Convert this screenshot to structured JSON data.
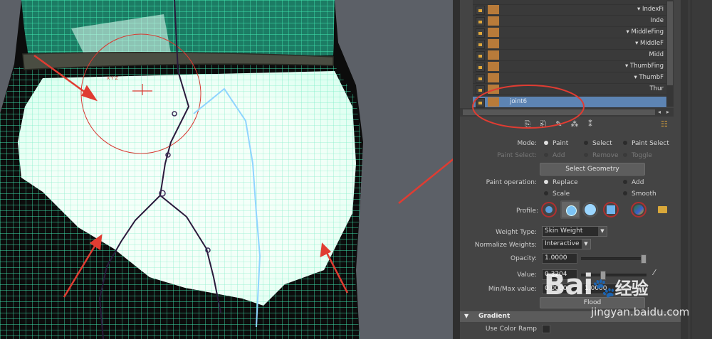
{
  "outliner": {
    "rows": [
      {
        "label": "IndexFi",
        "arrow": true
      },
      {
        "label": "Inde",
        "arrow": false
      },
      {
        "label": "MiddleFing",
        "arrow": true
      },
      {
        "label": "MiddleF",
        "arrow": true
      },
      {
        "label": "Midd",
        "arrow": false
      },
      {
        "label": "ThumbFing",
        "arrow": true
      },
      {
        "label": "ThumbF",
        "arrow": true
      },
      {
        "label": "Thur",
        "arrow": false
      },
      {
        "label": "joint6",
        "arrow": false,
        "selected": true
      }
    ]
  },
  "tool": {
    "mode_label": "Mode:",
    "mode_options": [
      "Paint",
      "Select",
      "Paint Select"
    ],
    "mode_selected": "Paint",
    "paint_select_label": "Paint Select:",
    "paint_select_options": [
      "Add",
      "Remove",
      "Toggle"
    ],
    "select_geometry_label": "Select Geometry",
    "paint_operation_label": "Paint operation:",
    "paint_operation_options": [
      "Replace",
      "Add",
      "Scale",
      "Smooth"
    ],
    "paint_operation_selected": "Replace",
    "profile_label": "Profile:",
    "weight_type_label": "Weight Type:",
    "weight_type_value": "Skin Weight",
    "normalize_label": "Normalize Weights:",
    "normalize_value": "Interactive",
    "opacity_label": "Opacity:",
    "opacity_value": "1.0000",
    "opacity_fraction": 1.0,
    "value_label": "Value:",
    "value_value": "0.3204",
    "value_fraction": 0.3204,
    "minmax_label": "Min/Max value:",
    "min_value": "0.0000",
    "max_value": "1.0000",
    "flood_label": "Flood",
    "gradient_section_label": "Gradient",
    "use_color_ramp_label": "Use Color Ramp"
  },
  "watermark": {
    "logo_text": "Bai",
    "logo_cn": "经验",
    "url": "jingyan.baidu.com"
  },
  "colors": {
    "selection_blue": "#5d84b3",
    "annotation_red": "#e03c32",
    "wireframe_green": "#3fe8b0",
    "weight_white": "#f4fff8"
  }
}
